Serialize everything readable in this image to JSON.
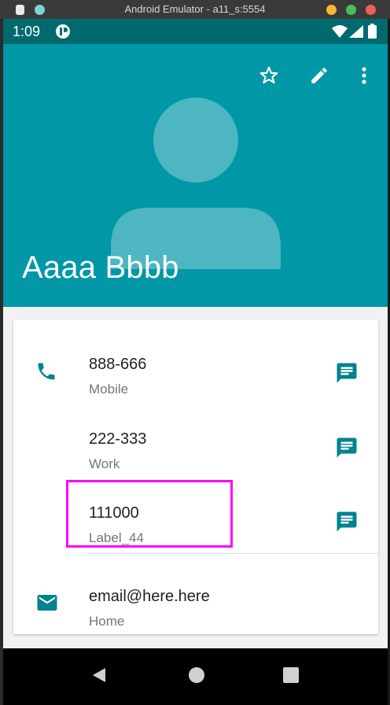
{
  "window": {
    "title": "Android Emulator - a11_s:5554"
  },
  "status_bar": {
    "time": "1:09"
  },
  "contact": {
    "name": "Aaaa Bbbb"
  },
  "entries": [
    {
      "value": "888-666",
      "label": "Mobile"
    },
    {
      "value": "222-333",
      "label": "Work"
    },
    {
      "value": "111000",
      "label": "Label_44"
    },
    {
      "value": "email@here.here",
      "label": "Home"
    }
  ],
  "colors": {
    "header": "#0097a7",
    "status_bar": "#006a6e",
    "accent": "#00838f",
    "highlight": "#ff00ff"
  },
  "icons": {
    "favorite": "star-outline-icon",
    "edit": "pencil-icon",
    "more": "more-vert-icon",
    "phone": "phone-icon",
    "email": "email-icon",
    "message": "message-icon"
  }
}
